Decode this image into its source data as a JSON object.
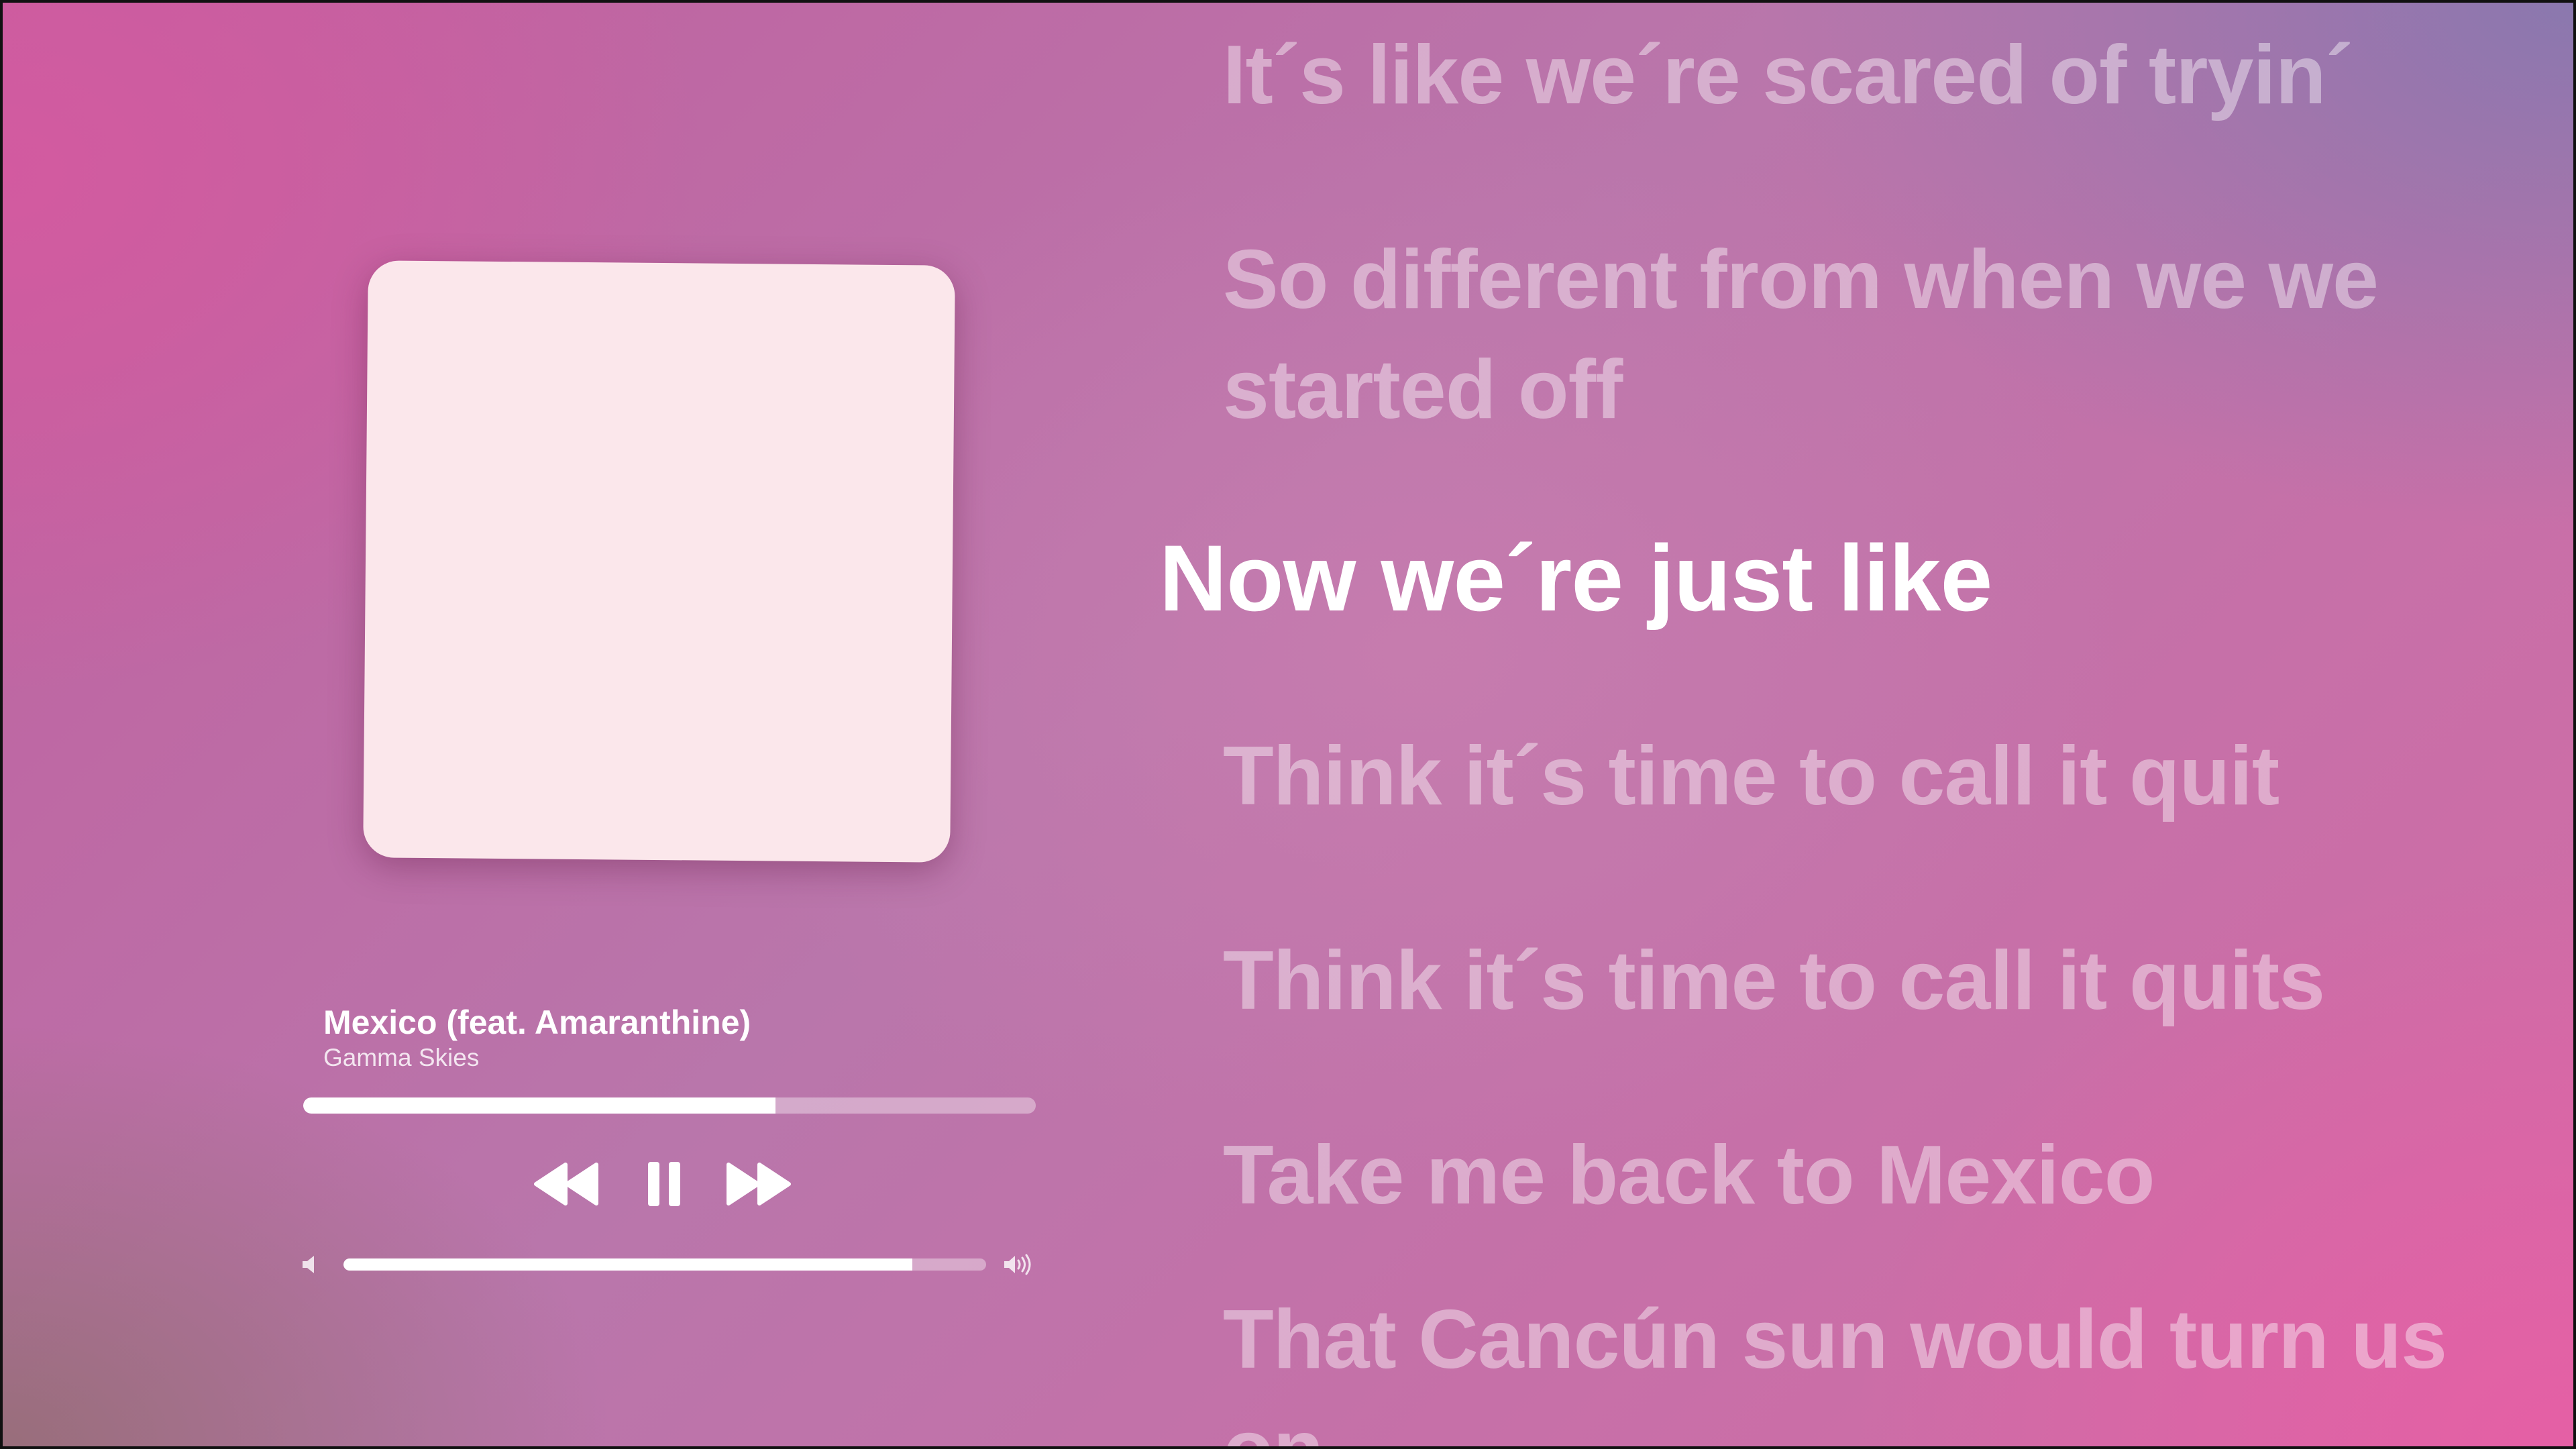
{
  "now_playing": {
    "title": "Mexico (feat. Amaranthine)",
    "artist": "Gamma Skies",
    "progress_fraction": 0.645,
    "volume_fraction": 0.885
  },
  "controls": {
    "rewind_icon": "rewind-icon",
    "pause_icon": "pause-icon",
    "forward_icon": "fast-forward-icon",
    "volume_low_icon": "volume-low-icon",
    "volume_high_icon": "volume-high-icon"
  },
  "lyrics": {
    "active_index": 2,
    "lines": [
      "It´s like we´re scared of tryin´",
      "So different from when we we started off",
      "Now we´re just like",
      "Think it´s time to call it quit",
      "Think it´s time to call it quits",
      "Take me back to Mexico",
      "That Cancún sun would turn us on"
    ]
  },
  "colors": {
    "accent": "#ffffff",
    "artwork_placeholder": "#fbe7eb"
  }
}
